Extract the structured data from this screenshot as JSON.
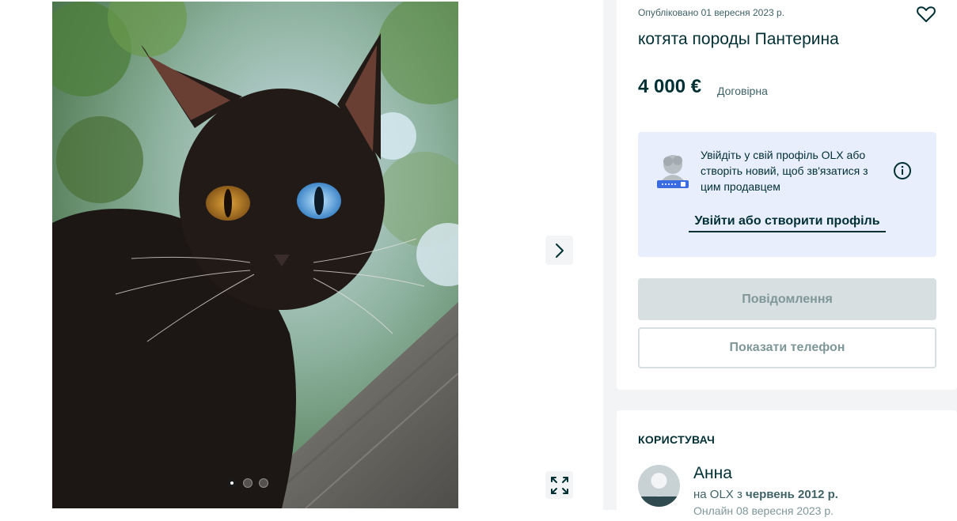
{
  "gallery": {
    "photo_alt": "котята породы Пантерина",
    "dots_total": 3,
    "active_dot": 1,
    "next_icon": "chevron-right-icon",
    "expand_icon": "expand-icon"
  },
  "ad": {
    "published": "Опубліковано 01 вересня 2023 р.",
    "title": "котята породы Пантерина",
    "price": "4 000 €",
    "price_note": "Договірна",
    "favorite_icon": "heart-icon"
  },
  "login_prompt": {
    "text": "Увійдіть у свій профіль OLX або створіть новий, щоб зв'язатися з цим продавцем",
    "link": "Увійти або створити профіль",
    "info_icon": "info-icon"
  },
  "actions": {
    "message_label": "Повідомлення",
    "phone_label": "Показати телефон"
  },
  "seller": {
    "heading": "КОРИСТУВАЧ",
    "name": "Анна",
    "since_prefix": "на OLX з",
    "since_date": "червень 2012 р.",
    "online": "Онлайн 08 вересня 2023 р."
  },
  "colors": {
    "text_primary": "#002f34",
    "text_secondary": "#406367",
    "login_bg": "#e8eefc",
    "disabled_btn": "#d8dfe0",
    "page_bg": "#f2f4f5"
  }
}
